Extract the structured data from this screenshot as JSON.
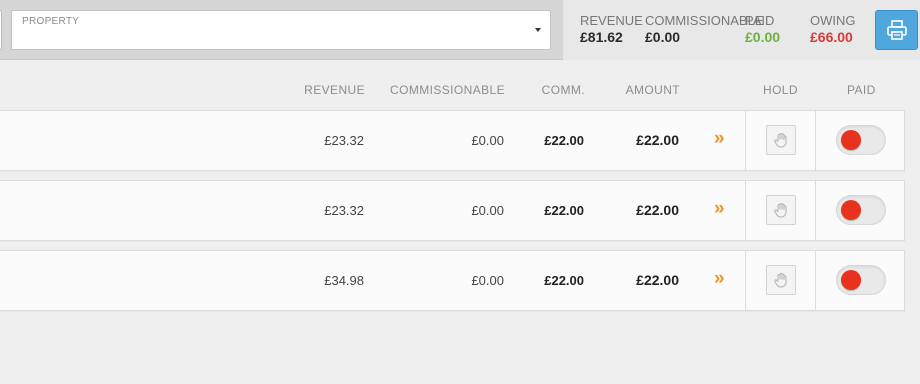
{
  "filter": {
    "property_label": "PROPERTY",
    "property_value": ""
  },
  "summary": {
    "revenue_label": "REVENUE",
    "revenue_value": "£81.62",
    "commissionable_label": "COMMISSIONABLE",
    "commissionable_value": "£0.00",
    "paid_label": "PAID",
    "paid_value": "£0.00",
    "owing_label": "OWING",
    "owing_value": "£66.00",
    "print_icon": "printer-icon"
  },
  "colors": {
    "paid_green": "#6cb33f",
    "owing_red": "#d83a3a",
    "print_blue": "#4fa7de",
    "chevron_orange": "#f0932b",
    "toggle_off_red": "#e8321e"
  },
  "table": {
    "columns": {
      "revenue": "REVENUE",
      "commissionable": "COMMISSIONABLE",
      "comm": "COMM.",
      "amount": "AMOUNT",
      "hold": "HOLD",
      "paid": "PAID"
    },
    "rows": [
      {
        "revenue": "£23.32",
        "commissionable": "£0.00",
        "comm": "£22.00",
        "amount": "£22.00",
        "paid": false
      },
      {
        "revenue": "£23.32",
        "commissionable": "£0.00",
        "comm": "£22.00",
        "amount": "£22.00",
        "paid": false
      },
      {
        "revenue": "£34.98",
        "commissionable": "£0.00",
        "comm": "£22.00",
        "amount": "£22.00",
        "paid": false
      }
    ],
    "chevron_glyph": "»",
    "hold_icon": "hand-icon"
  }
}
